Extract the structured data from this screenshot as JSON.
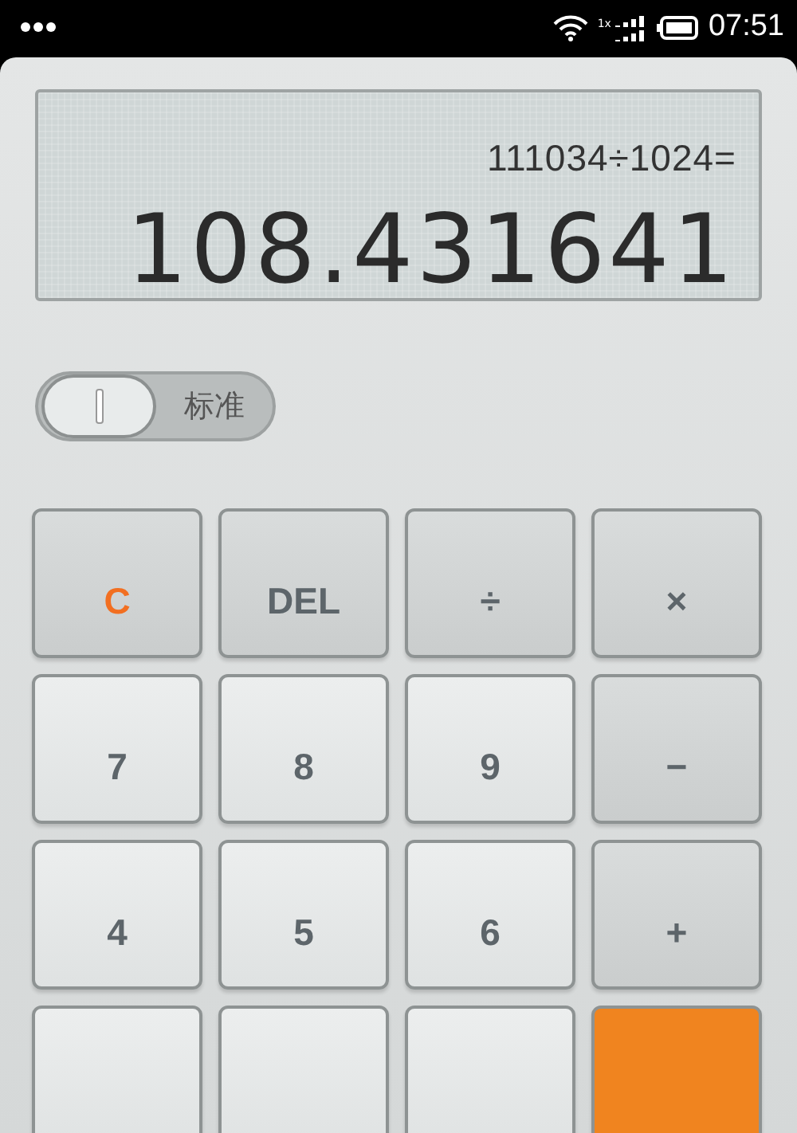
{
  "status_bar": {
    "network_type": "1x",
    "time": "07:51"
  },
  "display": {
    "expression": "111034÷1024=",
    "result": "108.431641"
  },
  "mode_switch": {
    "label": "标准",
    "on": false
  },
  "keys": [
    {
      "label": "C",
      "kind": "clear"
    },
    {
      "label": "DEL",
      "kind": "function"
    },
    {
      "label": "÷",
      "kind": "operator"
    },
    {
      "label": "×",
      "kind": "operator"
    },
    {
      "label": "7",
      "kind": "digit"
    },
    {
      "label": "8",
      "kind": "digit"
    },
    {
      "label": "9",
      "kind": "digit"
    },
    {
      "label": "−",
      "kind": "operator"
    },
    {
      "label": "4",
      "kind": "digit"
    },
    {
      "label": "5",
      "kind": "digit"
    },
    {
      "label": "6",
      "kind": "digit"
    },
    {
      "label": "+",
      "kind": "operator"
    },
    {
      "kind": "digit"
    },
    {
      "kind": "digit"
    },
    {
      "kind": "digit"
    },
    {
      "kind": "equals"
    }
  ]
}
